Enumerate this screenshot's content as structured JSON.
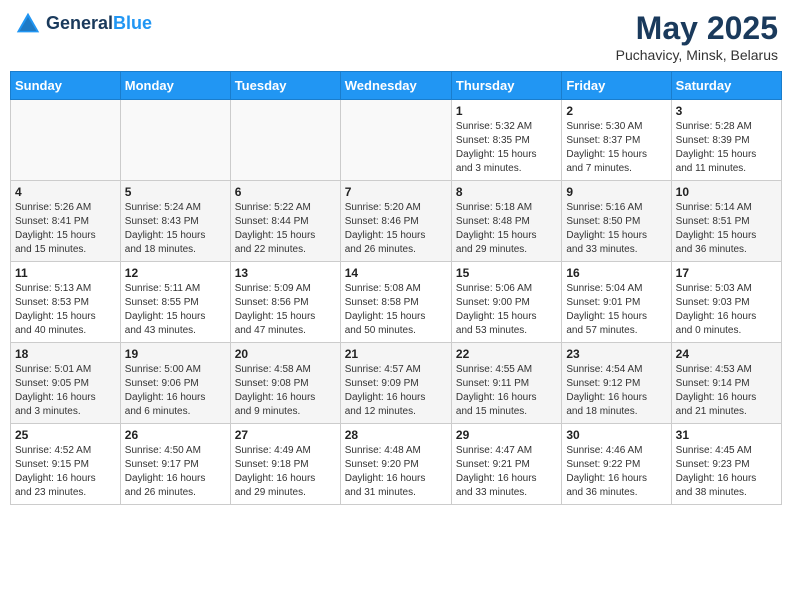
{
  "header": {
    "logo_line1": "General",
    "logo_line2": "Blue",
    "month_year": "May 2025",
    "location": "Puchavicy, Minsk, Belarus"
  },
  "days_of_week": [
    "Sunday",
    "Monday",
    "Tuesday",
    "Wednesday",
    "Thursday",
    "Friday",
    "Saturday"
  ],
  "weeks": [
    [
      {
        "day": "",
        "info": ""
      },
      {
        "day": "",
        "info": ""
      },
      {
        "day": "",
        "info": ""
      },
      {
        "day": "",
        "info": ""
      },
      {
        "day": "1",
        "info": "Sunrise: 5:32 AM\nSunset: 8:35 PM\nDaylight: 15 hours\nand 3 minutes."
      },
      {
        "day": "2",
        "info": "Sunrise: 5:30 AM\nSunset: 8:37 PM\nDaylight: 15 hours\nand 7 minutes."
      },
      {
        "day": "3",
        "info": "Sunrise: 5:28 AM\nSunset: 8:39 PM\nDaylight: 15 hours\nand 11 minutes."
      }
    ],
    [
      {
        "day": "4",
        "info": "Sunrise: 5:26 AM\nSunset: 8:41 PM\nDaylight: 15 hours\nand 15 minutes."
      },
      {
        "day": "5",
        "info": "Sunrise: 5:24 AM\nSunset: 8:43 PM\nDaylight: 15 hours\nand 18 minutes."
      },
      {
        "day": "6",
        "info": "Sunrise: 5:22 AM\nSunset: 8:44 PM\nDaylight: 15 hours\nand 22 minutes."
      },
      {
        "day": "7",
        "info": "Sunrise: 5:20 AM\nSunset: 8:46 PM\nDaylight: 15 hours\nand 26 minutes."
      },
      {
        "day": "8",
        "info": "Sunrise: 5:18 AM\nSunset: 8:48 PM\nDaylight: 15 hours\nand 29 minutes."
      },
      {
        "day": "9",
        "info": "Sunrise: 5:16 AM\nSunset: 8:50 PM\nDaylight: 15 hours\nand 33 minutes."
      },
      {
        "day": "10",
        "info": "Sunrise: 5:14 AM\nSunset: 8:51 PM\nDaylight: 15 hours\nand 36 minutes."
      }
    ],
    [
      {
        "day": "11",
        "info": "Sunrise: 5:13 AM\nSunset: 8:53 PM\nDaylight: 15 hours\nand 40 minutes."
      },
      {
        "day": "12",
        "info": "Sunrise: 5:11 AM\nSunset: 8:55 PM\nDaylight: 15 hours\nand 43 minutes."
      },
      {
        "day": "13",
        "info": "Sunrise: 5:09 AM\nSunset: 8:56 PM\nDaylight: 15 hours\nand 47 minutes."
      },
      {
        "day": "14",
        "info": "Sunrise: 5:08 AM\nSunset: 8:58 PM\nDaylight: 15 hours\nand 50 minutes."
      },
      {
        "day": "15",
        "info": "Sunrise: 5:06 AM\nSunset: 9:00 PM\nDaylight: 15 hours\nand 53 minutes."
      },
      {
        "day": "16",
        "info": "Sunrise: 5:04 AM\nSunset: 9:01 PM\nDaylight: 15 hours\nand 57 minutes."
      },
      {
        "day": "17",
        "info": "Sunrise: 5:03 AM\nSunset: 9:03 PM\nDaylight: 16 hours\nand 0 minutes."
      }
    ],
    [
      {
        "day": "18",
        "info": "Sunrise: 5:01 AM\nSunset: 9:05 PM\nDaylight: 16 hours\nand 3 minutes."
      },
      {
        "day": "19",
        "info": "Sunrise: 5:00 AM\nSunset: 9:06 PM\nDaylight: 16 hours\nand 6 minutes."
      },
      {
        "day": "20",
        "info": "Sunrise: 4:58 AM\nSunset: 9:08 PM\nDaylight: 16 hours\nand 9 minutes."
      },
      {
        "day": "21",
        "info": "Sunrise: 4:57 AM\nSunset: 9:09 PM\nDaylight: 16 hours\nand 12 minutes."
      },
      {
        "day": "22",
        "info": "Sunrise: 4:55 AM\nSunset: 9:11 PM\nDaylight: 16 hours\nand 15 minutes."
      },
      {
        "day": "23",
        "info": "Sunrise: 4:54 AM\nSunset: 9:12 PM\nDaylight: 16 hours\nand 18 minutes."
      },
      {
        "day": "24",
        "info": "Sunrise: 4:53 AM\nSunset: 9:14 PM\nDaylight: 16 hours\nand 21 minutes."
      }
    ],
    [
      {
        "day": "25",
        "info": "Sunrise: 4:52 AM\nSunset: 9:15 PM\nDaylight: 16 hours\nand 23 minutes."
      },
      {
        "day": "26",
        "info": "Sunrise: 4:50 AM\nSunset: 9:17 PM\nDaylight: 16 hours\nand 26 minutes."
      },
      {
        "day": "27",
        "info": "Sunrise: 4:49 AM\nSunset: 9:18 PM\nDaylight: 16 hours\nand 29 minutes."
      },
      {
        "day": "28",
        "info": "Sunrise: 4:48 AM\nSunset: 9:20 PM\nDaylight: 16 hours\nand 31 minutes."
      },
      {
        "day": "29",
        "info": "Sunrise: 4:47 AM\nSunset: 9:21 PM\nDaylight: 16 hours\nand 33 minutes."
      },
      {
        "day": "30",
        "info": "Sunrise: 4:46 AM\nSunset: 9:22 PM\nDaylight: 16 hours\nand 36 minutes."
      },
      {
        "day": "31",
        "info": "Sunrise: 4:45 AM\nSunset: 9:23 PM\nDaylight: 16 hours\nand 38 minutes."
      }
    ]
  ]
}
